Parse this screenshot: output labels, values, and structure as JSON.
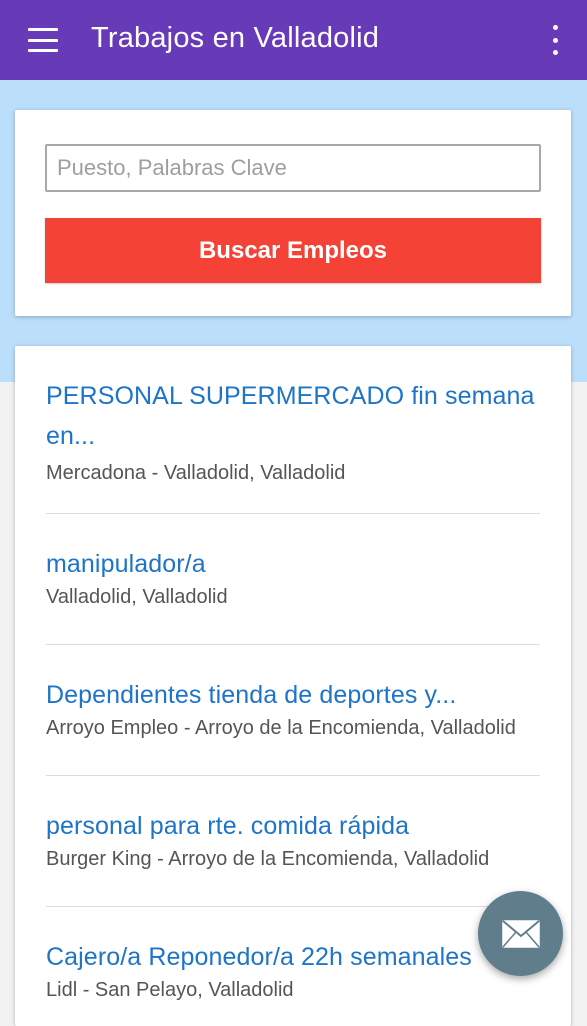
{
  "appbar": {
    "title": "Trabajos en Valladolid",
    "menu_icon": "hamburger-menu-icon",
    "more_icon": "more-vert-icon",
    "color": "#673ab7"
  },
  "search": {
    "placeholder": "Puesto, Palabras Clave",
    "value": "",
    "button_label": "Buscar Empleos",
    "button_color": "#f44336"
  },
  "jobs": [
    {
      "title_line1": "PERSONAL SUPERMERCADO fin semana",
      "title_line2": "en...",
      "meta": "Mercadona - Valladolid, Valladolid"
    },
    {
      "title": "manipulador/a",
      "meta": "Valladolid, Valladolid"
    },
    {
      "title": "Dependientes tienda de deportes y...",
      "meta": "Arroyo Empleo - Arroyo de la Encomienda, Valladolid"
    },
    {
      "title": "personal para rte. comida rápida",
      "meta": "Burger King - Arroyo de la Encomienda, Valladolid"
    },
    {
      "title": "Cajero/a Reponedor/a 22h semanales",
      "meta": "Lidl - San Pelayo, Valladolid"
    }
  ],
  "fab": {
    "icon": "mail-icon",
    "color": "#607d8b"
  },
  "colors": {
    "link": "#1e74c9",
    "band": "#bbdefb",
    "background": "#f2f2f2"
  }
}
